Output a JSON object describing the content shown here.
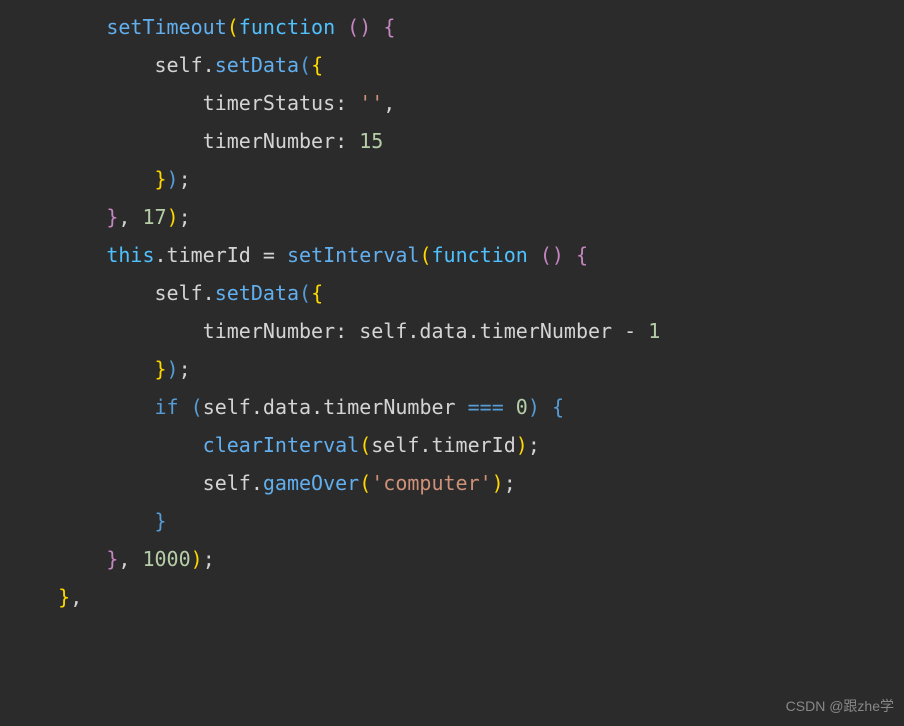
{
  "code": {
    "setTimeout": "setTimeout",
    "function": "function",
    "self": "self",
    "setData": "setData",
    "timerStatus": "timerStatus",
    "emptyString": "''",
    "timerNumber": "timerNumber",
    "fifteen": "15",
    "seventeen": "17",
    "this": "this",
    "timerId": "timerId",
    "setInterval": "setInterval",
    "data": "data",
    "minusOne": "1",
    "if": "if",
    "tripleEq": "===",
    "zero": "0",
    "clearInterval": "clearInterval",
    "gameOver": "gameOver",
    "computer": "'computer'",
    "thousand": "1000"
  },
  "watermark": "CSDN @跟zhe学"
}
